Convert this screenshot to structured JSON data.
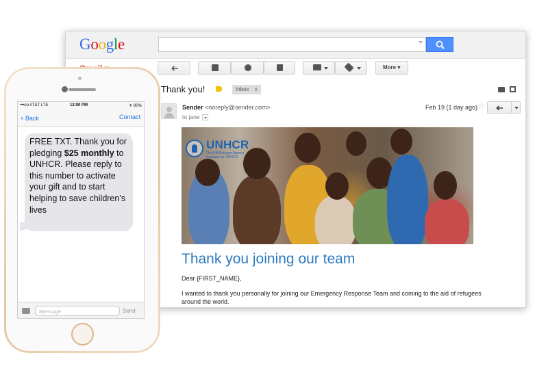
{
  "gmail": {
    "logo_letters": [
      "G",
      "o",
      "o",
      "g",
      "l",
      "e"
    ],
    "logo_colors": [
      "#3369e8",
      "#d50f25",
      "#eeb211",
      "#3369e8",
      "#009925",
      "#d50f25"
    ],
    "app_label": "Gmail ▾",
    "toolbar": {
      "more_label": "More ▾"
    },
    "subject": "Thank you!",
    "inbox_chip": "Inbox",
    "inbox_chip_close": "x",
    "sender_name": "Sender",
    "sender_email": "<noreply@sender.com>",
    "to_line": "to jane",
    "date": "Feb 19 (1 day ago)"
  },
  "email": {
    "logo_name": "UNHCR",
    "logo_sub1": "The UN Refugee Agency",
    "logo_sub2": "Australia for UNHCR",
    "heading": "Thank you joining our team",
    "greeting": "Dear {FIRST_NAME},",
    "paragraph": "I wanted to thank you personally for joining our Emergency Response Team and coming to the aid of refugees around the world."
  },
  "phone": {
    "status_carrier": "•••oo AT&T LTE",
    "status_time": "12:00 PM",
    "status_battery": "✈ 80%",
    "back_label": "Back",
    "contact_label": "Contact",
    "message": {
      "part1": "FREE TXT. Thank you for pledging ",
      "bold": "$25 monthly",
      "part2": " to UNHCR. Please reply to this number to activate your gift and to start helping to save children’s lives"
    },
    "input_placeholder": "iMessage",
    "send_label": "Send"
  },
  "colors": {
    "gmail_red": "#dd4b39",
    "search_blue": "#4d90fe",
    "unhcr_blue": "#1f63b0",
    "heading_blue": "#2b7bbf",
    "ios_blue": "#1a73e8",
    "bubble_gray": "#e5e5ea",
    "phone_gold": "#e2c8a4"
  }
}
